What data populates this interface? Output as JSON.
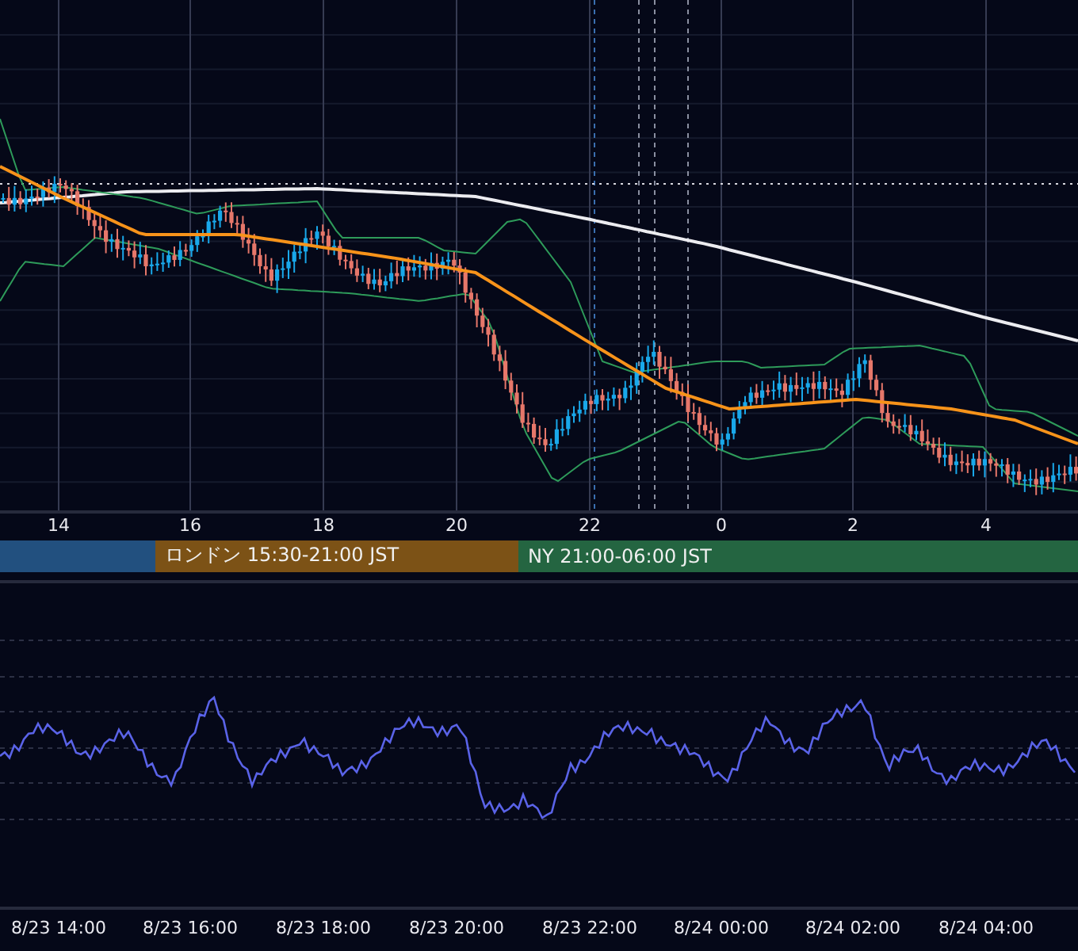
{
  "main_chart": {
    "time_axis": [
      "14",
      "16",
      "18",
      "20",
      "22",
      "0",
      "2",
      "4"
    ]
  },
  "sessions": [
    {
      "color": "#22507f"
    },
    {
      "label": "ロンドン 15:30-21:00 JST",
      "color": "#7c5216"
    },
    {
      "label": "NY 21:00-06:00 JST",
      "color": "#246541"
    }
  ],
  "oscillator": {
    "time_axis": [
      "8/23 14:00",
      "8/23 16:00",
      "8/23 18:00",
      "8/23 20:00",
      "8/23 22:00",
      "8/24 00:00",
      "8/24 02:00",
      "8/24 04:00"
    ]
  }
}
